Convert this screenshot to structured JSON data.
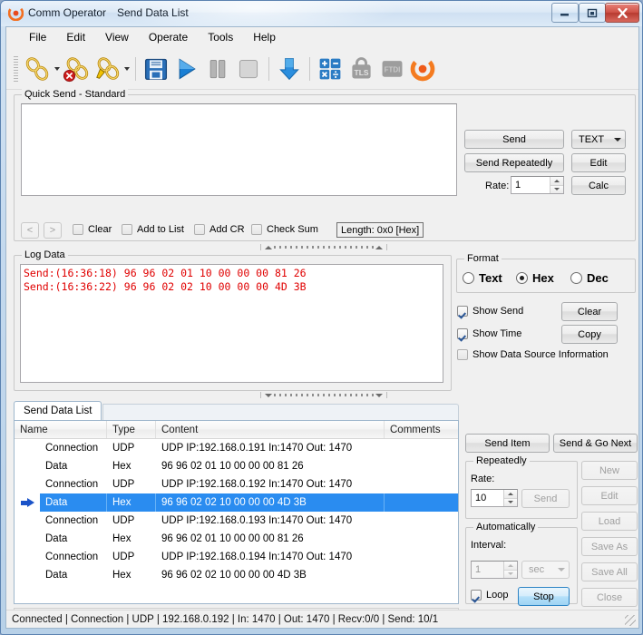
{
  "window": {
    "title": "Comm Operator",
    "subtitle": "Send Data List",
    "app_icon": "target-icon",
    "minimize": "–",
    "maximize": "❐",
    "close": "✕"
  },
  "menu": {
    "items": [
      {
        "label": "File"
      },
      {
        "label": "Edit"
      },
      {
        "label": "View"
      },
      {
        "label": "Operate"
      },
      {
        "label": "Tools"
      },
      {
        "label": "Help"
      }
    ]
  },
  "toolbar": {
    "items": [
      {
        "name": "connect-icon",
        "label": "Connect"
      },
      {
        "name": "connect-dropdown-arrow",
        "label": ""
      },
      {
        "name": "disconnect-icon",
        "label": "Disconnect"
      },
      {
        "name": "edit-connection-icon",
        "label": "Edit Connection"
      },
      {
        "name": "edit-connection-dropdown-arrow",
        "label": ""
      },
      {
        "name": "save-icon",
        "label": "Save"
      },
      {
        "name": "play-icon",
        "label": "Start"
      },
      {
        "name": "pause-icon",
        "label": "Pause"
      },
      {
        "name": "stop-icon",
        "label": "Stop"
      },
      {
        "name": "download-arrow-icon",
        "label": "Receive"
      },
      {
        "name": "calculator-icon",
        "label": "Calculator"
      },
      {
        "name": "tls-icon",
        "label": "TLS"
      },
      {
        "name": "ftdi-icon",
        "label": "FTDI"
      },
      {
        "name": "target-icon",
        "label": "About"
      }
    ]
  },
  "quick_send": {
    "title": "Quick Send - Standard",
    "editor_value": "",
    "send_label": "Send",
    "send_repeatedly_label": "Send Repeatedly",
    "rate_label": "Rate:",
    "rate_value": "1",
    "format_value": "TEXT",
    "edit_label": "Edit",
    "calc_label": "Calc",
    "prev_label": "<",
    "next_label": ">",
    "checkboxes": [
      {
        "label": "Clear",
        "checked": false
      },
      {
        "label": "Add to List",
        "checked": false
      },
      {
        "label": "Add CR",
        "checked": false
      },
      {
        "label": "Check Sum",
        "checked": false
      }
    ],
    "length_label": "Length: 0x0 [Hex]"
  },
  "log_data": {
    "title": "Log Data",
    "lines": [
      "Send:(16:36:18) 96 96 02 01 10 00 00 00 81 26",
      "Send:(16:36:22) 96 96 02 02 10 00 00 00 4D 3B"
    ],
    "text_color": "#e00000",
    "format_group_title": "Format",
    "format_options": [
      {
        "label": "Text",
        "selected": false
      },
      {
        "label": "Hex",
        "selected": true
      },
      {
        "label": "Dec",
        "selected": false
      }
    ],
    "options": [
      {
        "label": "Show Send",
        "checked": true
      },
      {
        "label": "Show Time",
        "checked": true
      },
      {
        "label": "Show Data Source Information",
        "checked": false
      }
    ],
    "clear_label": "Clear",
    "copy_label": "Copy"
  },
  "send_data_list": {
    "tab_label": "Send Data List",
    "columns": [
      "Name",
      "Type",
      "Content",
      "Comments"
    ],
    "rows": [
      {
        "name": "Connection",
        "type": "UDP",
        "content": "UDP IP:192.168.0.191 In:1470 Out: 1470",
        "comments": "",
        "selected": false
      },
      {
        "name": "Data",
        "type": "Hex",
        "content": "96 96 02 01 10 00 00 00 81 26",
        "comments": "",
        "selected": false
      },
      {
        "name": "Connection",
        "type": "UDP",
        "content": "UDP IP:192.168.0.192 In:1470 Out: 1470",
        "comments": "",
        "selected": false
      },
      {
        "name": "Data",
        "type": "Hex",
        "content": "96 96 02 02 10 00 00 00 4D 3B",
        "comments": "",
        "selected": true
      },
      {
        "name": "Connection",
        "type": "UDP",
        "content": "UDP IP:192.168.0.193 In:1470 Out: 1470",
        "comments": "",
        "selected": false
      },
      {
        "name": "Data",
        "type": "Hex",
        "content": "96 96 02 01 10 00 00 00 81 26",
        "comments": "",
        "selected": false
      },
      {
        "name": "Connection",
        "type": "UDP",
        "content": "UDP IP:192.168.0.194 In:1470 Out: 1470",
        "comments": "",
        "selected": false
      },
      {
        "name": "Data",
        "type": "Hex",
        "content": "96 96 02 02 10 00 00 00 4D 3B",
        "comments": "",
        "selected": false
      }
    ],
    "selection_color": "#2a8cf0"
  },
  "right_panel": {
    "send_item_label": "Send Item",
    "send_go_next_label": "Send & Go Next",
    "repeatedly": {
      "title": "Repeatedly",
      "rate_label": "Rate:",
      "rate_value": "10",
      "send_label": "Send"
    },
    "automatically": {
      "title": "Automatically",
      "interval_label": "Interval:",
      "interval_value": "1",
      "unit_value": "sec",
      "loop_label": "Loop",
      "loop_checked": true,
      "stop_label": "Stop"
    },
    "file_buttons": [
      {
        "label": "New",
        "enabled": false
      },
      {
        "label": "Edit",
        "enabled": false
      },
      {
        "label": "Load",
        "enabled": false
      },
      {
        "label": "Save As",
        "enabled": false
      },
      {
        "label": "Save All",
        "enabled": false
      },
      {
        "label": "Close",
        "enabled": false
      }
    ]
  },
  "status_bar": {
    "text": "Connected | Connection  | UDP | 192.168.0.192 | In: 1470 | Out:  1470 | Recv:0/0 | Send: 10/1"
  }
}
